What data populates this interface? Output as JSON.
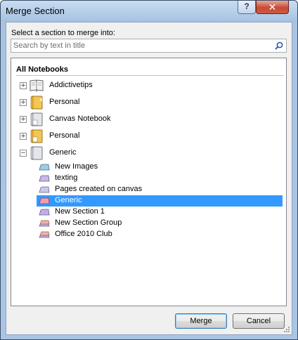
{
  "window": {
    "title": "Merge Section",
    "help_label": "?",
    "close_label": "✕"
  },
  "prompt": "Select a section to merge into:",
  "search": {
    "placeholder": "Search by text in title"
  },
  "tree": {
    "header": "All Notebooks",
    "notebooks": [
      {
        "label": "Addictivetips",
        "expander": "+",
        "icon": "open-book-icon"
      },
      {
        "label": "Personal",
        "expander": "+",
        "icon": "yellow-notebook-icon"
      },
      {
        "label": "Canvas Notebook",
        "expander": "+",
        "icon": "gray-notebook-icon"
      },
      {
        "label": "Personal",
        "expander": "+",
        "icon": "yellow-notebook-icon"
      },
      {
        "label": "Generic",
        "expander": "−",
        "icon": "gray-notebook-icon"
      }
    ],
    "sections": [
      {
        "label": "New Images",
        "color": "#9ecae6",
        "selected": false
      },
      {
        "label": "texting",
        "color": "#c7b6e6",
        "selected": false
      },
      {
        "label": "Pages created on canvas",
        "color": "#c8c6ea",
        "selected": false
      },
      {
        "label": "Generic",
        "color": "#e8a0b0",
        "selected": true
      },
      {
        "label": "New Section 1",
        "color": "#c0aee4",
        "selected": false
      },
      {
        "label": "New Section Group",
        "color": "#f0b4a8",
        "selected": false
      },
      {
        "label": "Office 2010 Club",
        "color": "#f0b4a8",
        "selected": false
      }
    ]
  },
  "buttons": {
    "merge": "Merge",
    "cancel": "Cancel"
  },
  "colors": {
    "selection": "#3399ff",
    "titlebar": "#aac5e4",
    "close": "#c74a35"
  }
}
